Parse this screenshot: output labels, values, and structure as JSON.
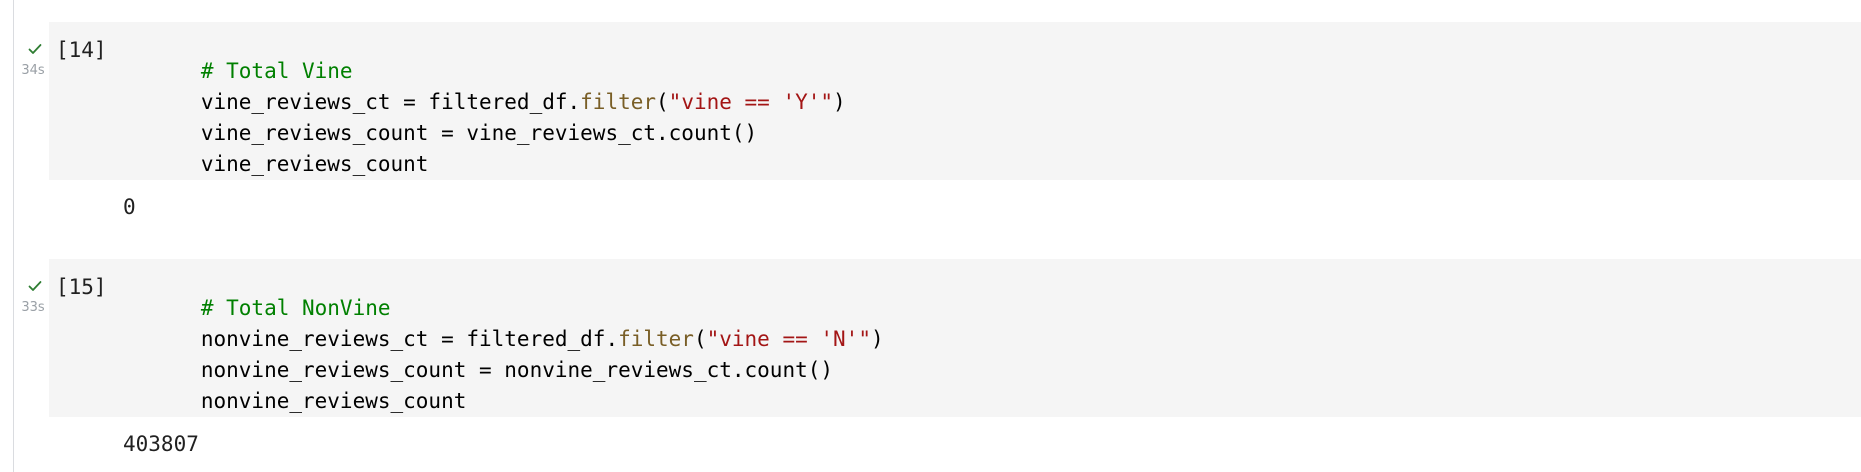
{
  "cells": [
    {
      "exec_count": "[14]",
      "exec_time": "34s",
      "status": "success",
      "status_icon": "check-icon",
      "code": [
        {
          "tokens": [
            {
              "text": "# Total Vine",
              "kind": "comment"
            }
          ]
        },
        {
          "tokens": [
            {
              "text": "vine_reviews_ct = filtered_df.",
              "kind": "plain"
            },
            {
              "text": "filter",
              "kind": "method"
            },
            {
              "text": "(",
              "kind": "plain"
            },
            {
              "text": "\"vine == 'Y'\"",
              "kind": "string"
            },
            {
              "text": ")",
              "kind": "plain"
            }
          ]
        },
        {
          "tokens": [
            {
              "text": "vine_reviews_count = vine_reviews_ct.count()",
              "kind": "plain"
            }
          ]
        },
        {
          "tokens": [
            {
              "text": "vine_reviews_count",
              "kind": "plain"
            }
          ]
        }
      ],
      "output": "0"
    },
    {
      "exec_count": "[15]",
      "exec_time": "33s",
      "status": "success",
      "status_icon": "check-icon",
      "code": [
        {
          "tokens": [
            {
              "text": "# Total NonVine",
              "kind": "comment"
            }
          ]
        },
        {
          "tokens": [
            {
              "text": "nonvine_reviews_ct = filtered_df.",
              "kind": "plain"
            },
            {
              "text": "filter",
              "kind": "method"
            },
            {
              "text": "(",
              "kind": "plain"
            },
            {
              "text": "\"vine == 'N'\"",
              "kind": "string"
            },
            {
              "text": ")",
              "kind": "plain"
            }
          ]
        },
        {
          "tokens": [
            {
              "text": "nonvine_reviews_count = nonvine_reviews_ct.count()",
              "kind": "plain"
            }
          ]
        },
        {
          "tokens": [
            {
              "text": "nonvine_reviews_count",
              "kind": "plain"
            }
          ]
        }
      ],
      "output": "403807"
    }
  ],
  "colors": {
    "success_check": "#2e7d32",
    "code_background": "#f5f5f5",
    "comment": "#008000",
    "method": "#795e26",
    "string": "#a31515"
  }
}
